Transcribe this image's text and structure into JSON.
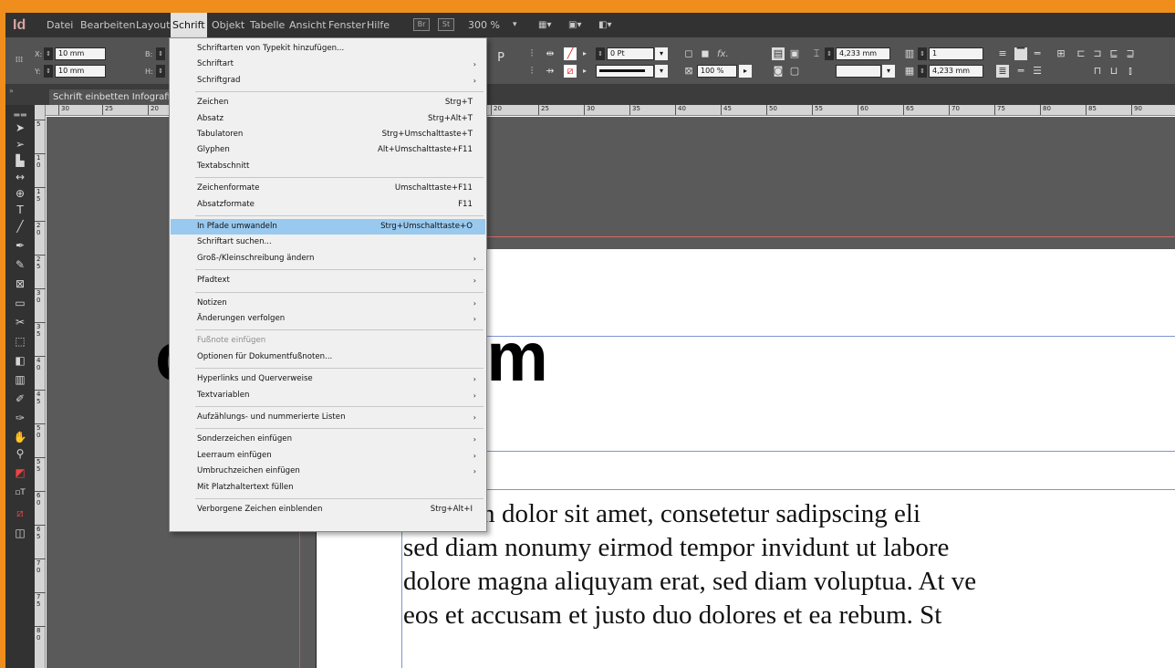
{
  "app": {
    "logo": "Id"
  },
  "menubar": {
    "items": [
      "Datei",
      "Bearbeiten",
      "Layout",
      "Schrift",
      "Objekt",
      "Tabelle",
      "Ansicht",
      "Fenster",
      "Hilfe"
    ],
    "bridge_label": "Br",
    "stock_label": "St",
    "zoom": "300 %"
  },
  "control": {
    "x_label": "X:",
    "x_value": "10 mm",
    "y_label": "Y:",
    "y_value": "10 mm",
    "w_label": "B:",
    "h_label": "H:",
    "stroke_weight": "0 Pt",
    "opacity": "100 %",
    "fx_label": "fx.",
    "gutter_top": "4,233 mm",
    "gutter_bottom": "4,233 mm",
    "columns": "1"
  },
  "document": {
    "tab_title": "Schrift einbetten Infografik.indd"
  },
  "ruler": {
    "h_ticks": [
      "30",
      "25",
      "20",
      "20",
      "25",
      "30",
      "35",
      "40",
      "45",
      "50",
      "55",
      "60",
      "65",
      "70",
      "75",
      "80",
      "85",
      "90",
      "95"
    ],
    "v_ticks": [
      "5",
      "1 0",
      "1 5",
      "2 0",
      "2 5",
      "3 0",
      "3 5",
      "4 0",
      "4 5",
      "5 0",
      "5 5",
      "6 0",
      "6 5",
      "7 0",
      "7 5",
      "8 0"
    ]
  },
  "canvas": {
    "headline": "orem Ipsum",
    "body_lines": [
      "m ipsum dolor sit amet, consetetur sadipscing eli",
      "sed diam nonumy eirmod tempor invidunt ut labore",
      "dolore magna aliquyam erat, sed diam voluptua. At ve",
      "eos et accusam et justo duo dolores et ea rebum. St"
    ]
  },
  "menu": {
    "items": [
      {
        "label": "Schriftarten von Typekit hinzufügen...",
        "shortcut": "",
        "submenu": false,
        "disabled": false
      },
      {
        "label": "Schriftart",
        "shortcut": "",
        "submenu": true,
        "disabled": false
      },
      {
        "label": "Schriftgrad",
        "shortcut": "",
        "submenu": true,
        "disabled": false
      },
      {
        "label": "Zeichen",
        "shortcut": "Strg+T",
        "submenu": false,
        "disabled": false
      },
      {
        "label": "Absatz",
        "shortcut": "Strg+Alt+T",
        "submenu": false,
        "disabled": false
      },
      {
        "label": "Tabulatoren",
        "shortcut": "Strg+Umschalttaste+T",
        "submenu": false,
        "disabled": false
      },
      {
        "label": "Glyphen",
        "shortcut": "Alt+Umschalttaste+F11",
        "submenu": false,
        "disabled": false
      },
      {
        "label": "Textabschnitt",
        "shortcut": "",
        "submenu": false,
        "disabled": false
      },
      {
        "label": "Zeichenformate",
        "shortcut": "Umschalttaste+F11",
        "submenu": false,
        "disabled": false
      },
      {
        "label": "Absatzformate",
        "shortcut": "F11",
        "submenu": false,
        "disabled": false
      },
      {
        "label": "In Pfade umwandeln",
        "shortcut": "Strg+Umschalttaste+O",
        "submenu": false,
        "disabled": false,
        "highlighted": true
      },
      {
        "label": "Schriftart suchen...",
        "shortcut": "",
        "submenu": false,
        "disabled": false
      },
      {
        "label": "Groß-/Kleinschreibung ändern",
        "shortcut": "",
        "submenu": true,
        "disabled": false
      },
      {
        "label": "Pfadtext",
        "shortcut": "",
        "submenu": true,
        "disabled": false
      },
      {
        "label": "Notizen",
        "shortcut": "",
        "submenu": true,
        "disabled": false
      },
      {
        "label": "Änderungen verfolgen",
        "shortcut": "",
        "submenu": true,
        "disabled": false
      },
      {
        "label": "Fußnote einfügen",
        "shortcut": "",
        "submenu": false,
        "disabled": true
      },
      {
        "label": "Optionen für Dokumentfußnoten...",
        "shortcut": "",
        "submenu": false,
        "disabled": false
      },
      {
        "label": "Hyperlinks und Querverweise",
        "shortcut": "",
        "submenu": true,
        "disabled": false
      },
      {
        "label": "Textvariablen",
        "shortcut": "",
        "submenu": true,
        "disabled": false
      },
      {
        "label": "Aufzählungs- und nummerierte Listen",
        "shortcut": "",
        "submenu": true,
        "disabled": false
      },
      {
        "label": "Sonderzeichen einfügen",
        "shortcut": "",
        "submenu": true,
        "disabled": false
      },
      {
        "label": "Leerraum einfügen",
        "shortcut": "",
        "submenu": true,
        "disabled": false
      },
      {
        "label": "Umbruchzeichen einfügen",
        "shortcut": "",
        "submenu": true,
        "disabled": false
      },
      {
        "label": "Mit Platzhaltertext füllen",
        "shortcut": "",
        "submenu": false,
        "disabled": false
      },
      {
        "label": "Verborgene Zeichen einblenden",
        "shortcut": "Strg+Alt+I",
        "submenu": false,
        "disabled": false
      }
    ]
  }
}
